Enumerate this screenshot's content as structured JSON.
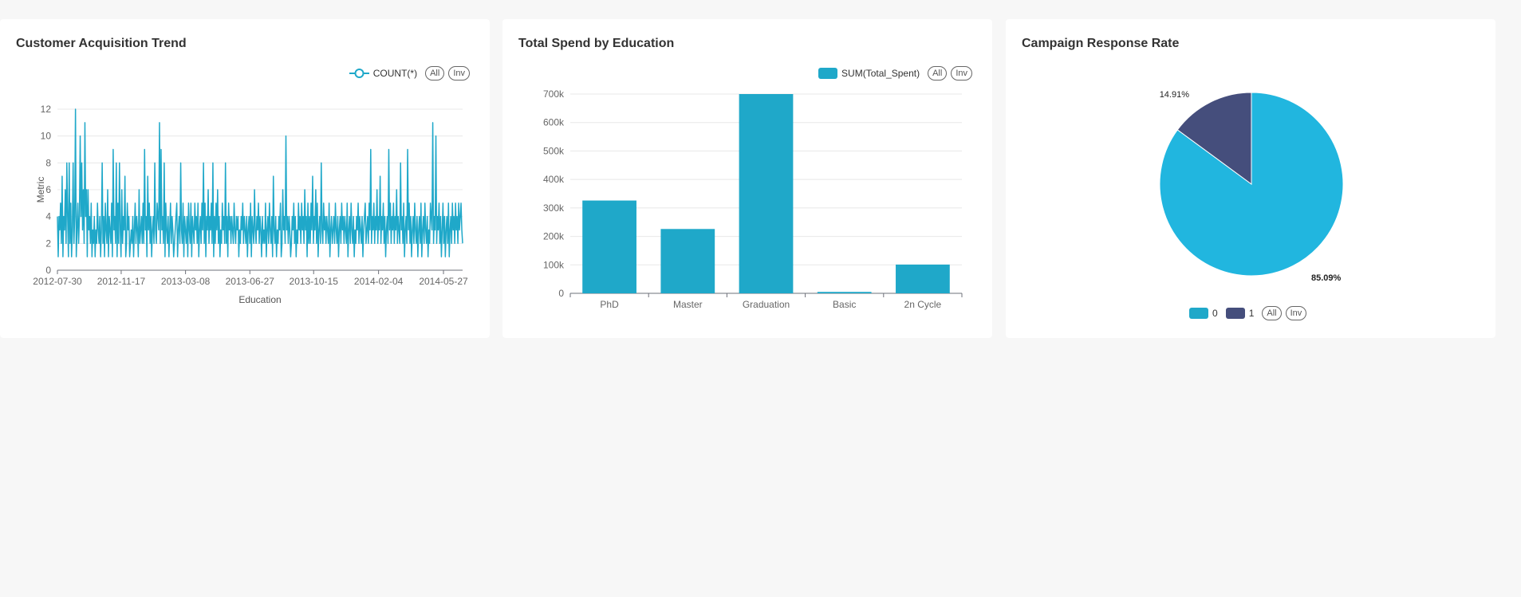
{
  "cards": [
    {
      "title": "Customer Acquisition Trend",
      "legend": [
        "COUNT(*)"
      ]
    },
    {
      "title": "Total Spend by Education",
      "legend": [
        "SUM(Total_Spent)"
      ]
    },
    {
      "title": "Campaign Response Rate",
      "legend": [
        "0",
        "1"
      ]
    }
  ],
  "legend_buttons": {
    "all": "All",
    "inv": "Inv"
  },
  "colors": {
    "primary": "#1fa8c9",
    "secondary": "#454e7c",
    "pie_primary": "#21b6df"
  },
  "chart_data": [
    {
      "type": "line",
      "title": "Customer Acquisition Trend",
      "xlabel": "Education",
      "ylabel": "Metric",
      "series": [
        {
          "name": "COUNT(*)",
          "values": [
            4,
            1,
            4,
            3,
            5,
            2,
            7,
            1,
            4,
            3,
            6,
            2,
            8,
            4,
            1,
            8,
            2,
            5,
            1,
            3,
            8,
            2,
            4,
            12,
            1,
            3,
            5,
            2,
            4,
            10,
            4,
            8,
            3,
            6,
            2,
            11,
            4,
            6,
            1,
            6,
            3,
            4,
            2,
            5,
            1,
            3,
            2,
            4,
            1,
            3,
            2,
            5,
            3,
            2,
            4,
            1,
            3,
            8,
            2,
            4,
            1,
            5,
            3,
            2,
            6,
            1,
            4,
            3,
            2,
            5,
            1,
            9,
            3,
            4,
            2,
            8,
            1,
            5,
            2,
            8,
            3,
            1,
            6,
            2,
            4,
            3,
            7,
            1,
            2,
            5,
            3,
            4,
            1,
            2,
            3,
            2,
            4,
            1,
            3,
            5,
            2,
            4,
            3,
            1,
            6,
            2,
            3,
            4,
            2,
            5,
            2,
            9,
            3,
            4,
            1,
            7,
            3,
            5,
            2,
            4,
            1,
            3,
            4,
            2,
            8,
            3,
            2,
            5,
            4,
            3,
            11,
            2,
            9,
            3,
            4,
            2,
            8,
            1,
            5,
            3,
            2,
            4,
            1,
            3,
            5,
            2,
            4,
            3,
            1,
            2,
            3,
            4,
            5,
            1,
            3,
            4,
            2,
            8,
            3,
            2,
            5,
            1,
            4,
            3,
            2,
            4,
            1,
            5,
            3,
            2,
            5,
            1,
            4,
            3,
            2,
            5,
            3,
            4,
            2,
            5,
            1,
            3,
            4,
            2,
            5,
            3,
            8,
            2,
            5,
            1,
            4,
            3,
            6,
            2,
            4,
            3,
            5,
            2,
            8,
            1,
            4,
            2,
            5,
            3,
            6,
            2,
            4,
            1,
            3,
            2,
            5,
            3,
            4,
            2,
            8,
            2,
            4,
            1,
            5,
            3,
            4,
            2,
            4,
            3,
            2,
            5,
            3,
            2,
            4,
            3,
            4,
            1,
            3,
            2,
            4,
            3,
            5,
            2,
            4,
            3,
            2,
            4,
            1,
            3,
            4,
            2,
            5,
            1,
            4,
            3,
            2,
            6,
            3,
            2,
            4,
            3,
            5,
            2,
            4,
            3,
            1,
            4,
            2,
            3,
            2,
            5,
            1,
            3,
            4,
            2,
            5,
            3,
            2,
            4,
            1,
            7,
            3,
            2,
            4,
            1,
            3,
            2,
            4,
            3,
            5,
            1,
            2,
            6,
            3,
            4,
            2,
            10,
            3,
            4,
            2,
            4,
            3,
            1,
            2,
            4,
            3,
            5,
            2,
            4,
            1,
            3,
            2,
            5,
            3,
            4,
            2,
            5,
            3,
            4,
            2,
            6,
            3,
            4,
            1,
            5,
            2,
            4,
            2,
            5,
            3,
            7,
            2,
            4,
            3,
            6,
            2,
            5,
            1,
            3,
            4,
            2,
            8,
            3,
            2,
            5,
            3,
            4,
            2,
            4,
            3,
            2,
            5,
            1,
            3,
            4,
            2,
            3,
            4,
            2,
            5,
            3,
            2,
            4,
            1,
            3,
            4,
            2,
            5,
            3,
            4,
            2,
            4,
            3,
            2,
            5,
            1,
            3,
            4,
            2,
            5,
            3,
            2,
            4,
            1,
            3,
            2,
            4,
            3,
            5,
            2,
            4,
            3,
            2,
            4,
            1,
            3,
            4,
            5,
            2,
            3,
            4,
            2,
            5,
            3,
            9,
            2,
            4,
            3,
            5,
            2,
            4,
            3,
            6,
            2,
            4,
            3,
            7,
            2,
            4,
            3,
            5,
            2,
            4,
            1,
            3,
            4,
            2,
            9,
            3,
            5,
            2,
            4,
            3,
            5,
            2,
            4,
            3,
            6,
            2,
            4,
            3,
            2,
            8,
            3,
            4,
            2,
            5,
            1,
            3,
            4,
            2,
            9,
            3,
            5,
            2,
            4,
            1,
            3,
            4,
            2,
            5,
            3,
            2,
            4,
            1,
            3,
            4,
            2,
            5,
            1,
            3,
            4,
            2,
            5,
            3,
            2,
            4,
            1,
            3,
            2,
            5,
            4,
            3,
            11,
            2,
            4,
            3,
            10,
            2,
            4,
            3,
            5,
            2,
            4,
            1,
            3,
            5,
            2,
            4,
            1,
            3,
            4,
            2,
            5,
            1,
            3,
            4,
            2,
            5,
            3,
            4,
            2,
            5,
            3,
            4,
            2,
            5,
            3,
            4,
            5,
            3,
            2
          ]
        }
      ],
      "x_ticks": [
        "2012-07-30",
        "2012-11-17",
        "2013-03-08",
        "2013-06-27",
        "2013-10-15",
        "2014-02-04",
        "2014-05-27"
      ],
      "x_range": [
        "2012-07-30",
        "2014-06-29"
      ],
      "ylim": [
        0,
        12
      ],
      "y_ticks": [
        0,
        2,
        4,
        6,
        8,
        10,
        12
      ],
      "grid": true,
      "legend_position": "top-right"
    },
    {
      "type": "bar",
      "title": "Total Spend by Education",
      "categories": [
        "PhD",
        "Master",
        "Graduation",
        "Basic",
        "2n Cycle"
      ],
      "series": [
        {
          "name": "SUM(Total_Spent)",
          "values": [
            326000,
            226000,
            700000,
            5000,
            101000
          ]
        }
      ],
      "ylim": [
        0,
        700000
      ],
      "y_ticks": [
        "0",
        "100k",
        "200k",
        "300k",
        "400k",
        "500k",
        "600k",
        "700k"
      ],
      "grid": true,
      "legend_position": "top-right"
    },
    {
      "type": "pie",
      "title": "Campaign Response Rate",
      "labels": [
        "0",
        "1"
      ],
      "values": [
        85.09,
        14.91
      ],
      "value_labels": [
        "85.09%",
        "14.91%"
      ],
      "legend_position": "bottom"
    }
  ]
}
